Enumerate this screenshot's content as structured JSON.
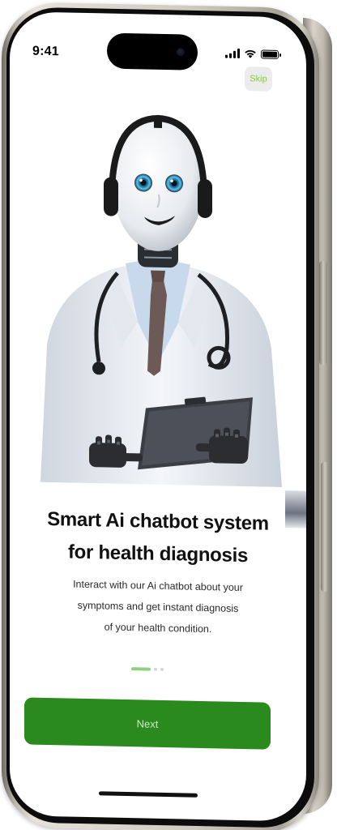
{
  "status_bar": {
    "time": "9:41",
    "icons": [
      "cellular-signal-icon",
      "wifi-icon",
      "battery-icon"
    ]
  },
  "onboarding": {
    "skip_label": "Skip",
    "title_line1": "Smart Ai chatbot system",
    "title_line2": "for health diagnosis",
    "description_line1": "Interact with our Ai chatbot about your",
    "description_line2": "symptoms and get instant diagnosis",
    "description_line3": "of your health condition.",
    "page_count": 3,
    "active_page": 1,
    "next_label": "Next",
    "illustration": "robot-doctor-illustration"
  },
  "colors": {
    "primary": "#2a8a1e",
    "accent_light": "#8fcf83",
    "skip_text": "#8bc34a",
    "skip_bg": "#ececec"
  }
}
